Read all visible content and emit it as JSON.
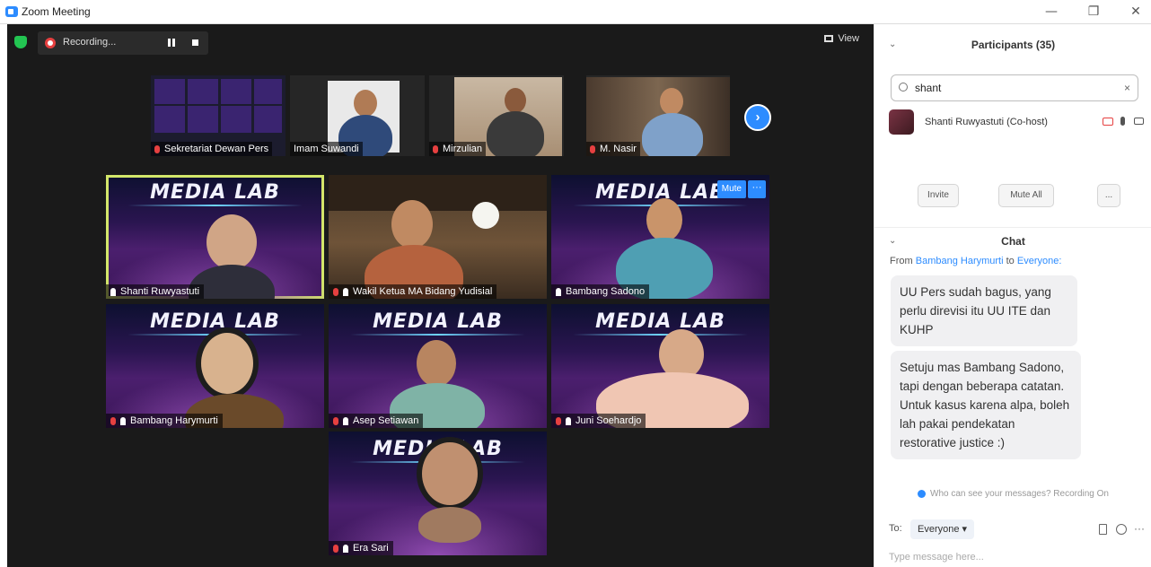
{
  "window": {
    "title": "Zoom Meeting",
    "minimize": "—",
    "maximize": "❐",
    "close": "✕"
  },
  "toolbar": {
    "recording_label": "Recording...",
    "view_label": "View"
  },
  "thumbnails": [
    {
      "name": "Sekretariat Dewan Pers",
      "muted": true
    },
    {
      "name": "Imam Suwandi",
      "muted": false
    },
    {
      "name": "Mirzulian",
      "muted": true
    },
    {
      "name": "M. Nasir",
      "muted": true
    }
  ],
  "grid": [
    {
      "banner": "MEDIA LAB",
      "name": "Shanti Ruwyastuti"
    },
    {
      "banner": "",
      "name": "Wakil Ketua MA Bidang Yudisial"
    },
    {
      "banner": "MEDIA LAB",
      "name": "Bambang Sadono"
    },
    {
      "banner": "MEDIA LAB",
      "name": "Bambang Harymurti"
    },
    {
      "banner": "MEDIA LAB",
      "name": "Asep Setiawan"
    },
    {
      "banner": "MEDIA LAB",
      "name": "Juni Soehardjo"
    },
    {
      "banner": "MEDIA LAB",
      "name": "Era Sari"
    }
  ],
  "tile_actions": {
    "mute": "Mute",
    "more": "···"
  },
  "next_arrow": "›",
  "participants": {
    "header": "Participants (35)",
    "search_value": "shant",
    "clear": "×",
    "list": [
      {
        "name": "Shanti Ruwyastuti (Co-host)"
      }
    ],
    "buttons": {
      "invite": "Invite",
      "mute_all": "Mute All",
      "more": "..."
    }
  },
  "chat": {
    "header": "Chat",
    "from_prefix": "From",
    "from_name": "Bambang Harymurti",
    "to_prefix": "to",
    "to_name": "Everyone:",
    "messages": [
      "UU Pers sudah bagus, yang perlu direvisi itu UU ITE dan KUHP",
      "Setuju mas Bambang Sadono, tapi dengan beberapa catatan. Untuk kasus karena alpa, boleh lah pakai pendekatan restorative justice :)"
    ],
    "notice": "Who can see your messages? Recording On",
    "to_label": "To:",
    "to_value": "Everyone ▾",
    "placeholder": "Type message here...",
    "more": "···"
  },
  "colors": {
    "accent": "#2d8cff",
    "active_speaker": "#d3e66a",
    "meeting_bg": "#1a1a1a",
    "muted_red": "#e64040"
  }
}
